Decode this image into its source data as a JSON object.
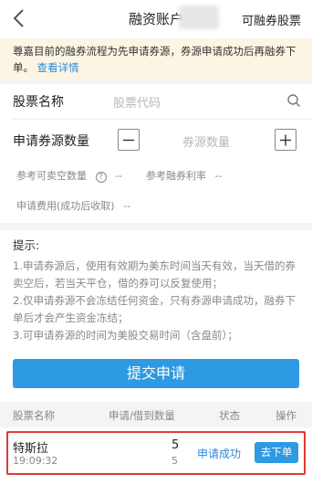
{
  "header": {
    "title": "融资账户",
    "right_link": "可融券股票"
  },
  "notice": {
    "text": "尊嘉目前的融券流程为先申请券源，券源申请成功后再融券下单。",
    "link": "查看详情"
  },
  "form": {
    "stock_label": "股票名称",
    "stock_placeholder": "股票代码",
    "qty_label": "申请券源数量",
    "qty_placeholder": "券源数量",
    "short_qty_label": "参考可卖空数量",
    "short_qty_help": "?",
    "short_qty_value": "--",
    "rate_label": "参考融券利率",
    "rate_value": "--",
    "fee_label": "申请费用(成功后收取)",
    "fee_value": "--"
  },
  "tips": {
    "title": "提示:",
    "line1": "1.申请券源后，使用有效期为美东时间当天有效，当天借的券卖空后，若当天平仓，借的券可以反复使用；",
    "line2": "2.仅申请券源不会冻结任何资金，只有券源申请成功，融券下单后才会产生资金冻结；",
    "line3": "3.可申请券源的时间为美股交易时间（含盘前）；"
  },
  "submit_label": "提交申请",
  "table": {
    "headers": [
      "股票名称",
      "申请/借到数量",
      "状态",
      "操作"
    ],
    "rows": [
      {
        "name": "特斯拉",
        "time": "19:09:32",
        "applied": "5",
        "borrowed": "5",
        "status": "申请成功",
        "action": "去下单"
      }
    ]
  },
  "colors": {
    "accent": "#2d9ae3",
    "link": "#2a8ad8",
    "notice_bg": "#fdf5e4",
    "highlight": "#e03a3a"
  }
}
